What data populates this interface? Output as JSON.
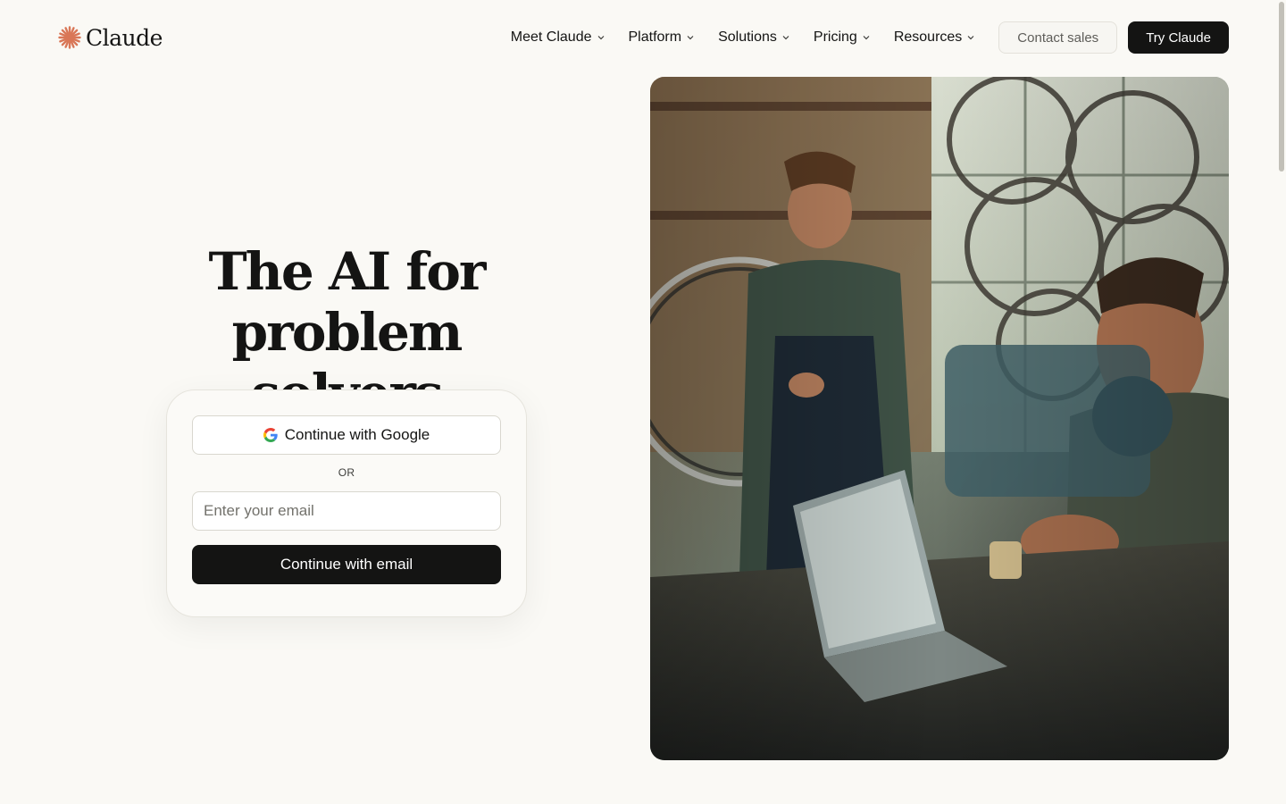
{
  "brand": {
    "name": "Claude",
    "accent_color": "#d97757",
    "icon": "claude-starburst-icon"
  },
  "nav": {
    "items": [
      {
        "label": "Meet Claude",
        "icon": "chevron-down-icon"
      },
      {
        "label": "Platform",
        "icon": "chevron-down-icon"
      },
      {
        "label": "Solutions",
        "icon": "chevron-down-icon"
      },
      {
        "label": "Pricing",
        "icon": "chevron-down-icon"
      },
      {
        "label": "Resources",
        "icon": "chevron-down-icon"
      }
    ],
    "contact_sales": "Contact sales",
    "try_claude": "Try Claude"
  },
  "hero": {
    "title_line1": "The AI for",
    "title_line2": "problem solvers",
    "google_button": "Continue with Google",
    "google_icon": "google-g-icon",
    "divider": "OR",
    "email_placeholder": "Enter your email",
    "email_value": "",
    "email_button": "Continue with email"
  },
  "media": {
    "description_icon": "hero-photo-workshop"
  },
  "colors": {
    "background": "#faf9f5",
    "text": "#141413",
    "dark_button": "#141413"
  }
}
